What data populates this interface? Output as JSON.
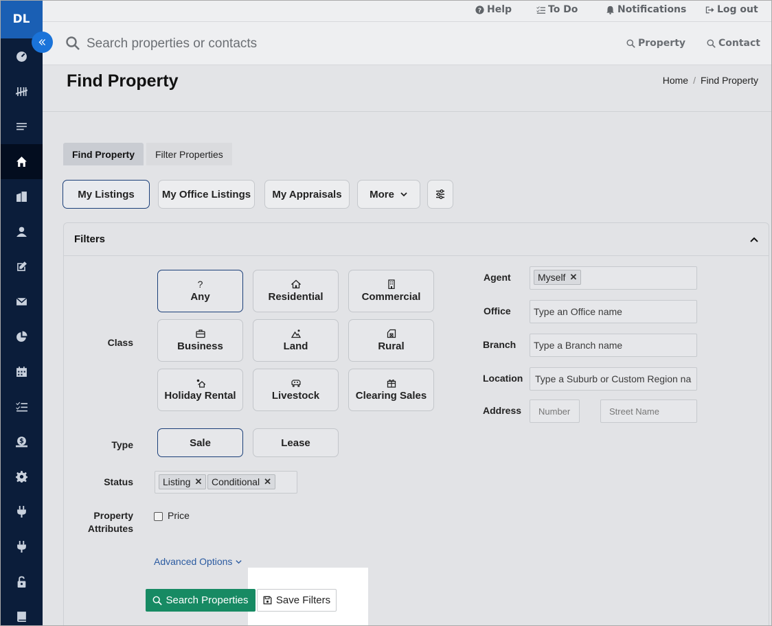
{
  "sidebar": {
    "logo": "DL",
    "collapse_icon": "chevrons-left-icon",
    "items": [
      {
        "icon": "dashboard-icon"
      },
      {
        "icon": "tally-icon"
      },
      {
        "icon": "list-icon"
      },
      {
        "icon": "home-icon",
        "active": true
      },
      {
        "icon": "buildings-icon"
      },
      {
        "icon": "user-icon"
      },
      {
        "icon": "edit-icon"
      },
      {
        "icon": "mail-icon"
      },
      {
        "icon": "pie-chart-icon"
      },
      {
        "icon": "calendar-icon"
      },
      {
        "icon": "checklist-icon"
      },
      {
        "icon": "money-icon"
      },
      {
        "icon": "gear-icon"
      },
      {
        "icon": "plug-icon"
      },
      {
        "icon": "plug-icon"
      },
      {
        "icon": "lock-icon"
      },
      {
        "icon": "book-icon"
      }
    ]
  },
  "topbar": {
    "help": "Help",
    "todo": "To Do",
    "notifications": "Notifications",
    "logout": "Log out",
    "search_placeholder": "Search properties or contacts",
    "property": "Property",
    "contact": "Contact"
  },
  "titlebar": {
    "title": "Find Property",
    "breadcrumb_home": "Home",
    "breadcrumb_sep": "/",
    "breadcrumb_current": "Find Property"
  },
  "tabs": {
    "find": "Find Property",
    "filter": "Filter Properties"
  },
  "quick": {
    "my_listings": "My Listings",
    "my_office_listings": "My Office Listings",
    "my_appraisals": "My Appraisals",
    "more": "More"
  },
  "filters": {
    "title": "Filters",
    "class_label": "Class",
    "classes": {
      "any_glyph": "?",
      "any": "Any",
      "residential": "Residential",
      "commercial": "Commercial",
      "business": "Business",
      "land": "Land",
      "rural": "Rural",
      "holiday_rental": "Holiday Rental",
      "livestock": "Livestock",
      "clearing_sales": "Clearing Sales"
    },
    "type_label": "Type",
    "type_sale": "Sale",
    "type_lease": "Lease",
    "status_label": "Status",
    "status_tags": [
      "Listing",
      "Conditional"
    ],
    "attributes_label_1": "Property",
    "attributes_label_2": "Attributes",
    "price_label": "Price",
    "advanced": "Advanced Options",
    "agent_label": "Agent",
    "agent_tag": "Myself",
    "tag_remove": "✕",
    "office_label": "Office",
    "office_placeholder": "Type an Office name",
    "branch_label": "Branch",
    "branch_placeholder": "Type a Branch name",
    "location_label": "Location",
    "location_placeholder": "Type a Suburb or Custom Region na",
    "address_label": "Address",
    "number_placeholder": "Number",
    "street_placeholder": "Street Name"
  },
  "actions": {
    "search": "Search Properties",
    "save": "Save Filters"
  },
  "colors": {
    "sidebar": "#0b1d3a",
    "logo": "#1a5fb4",
    "accent_border": "#1a3e78",
    "search_button": "#178a63",
    "link": "#2a5aa0"
  }
}
